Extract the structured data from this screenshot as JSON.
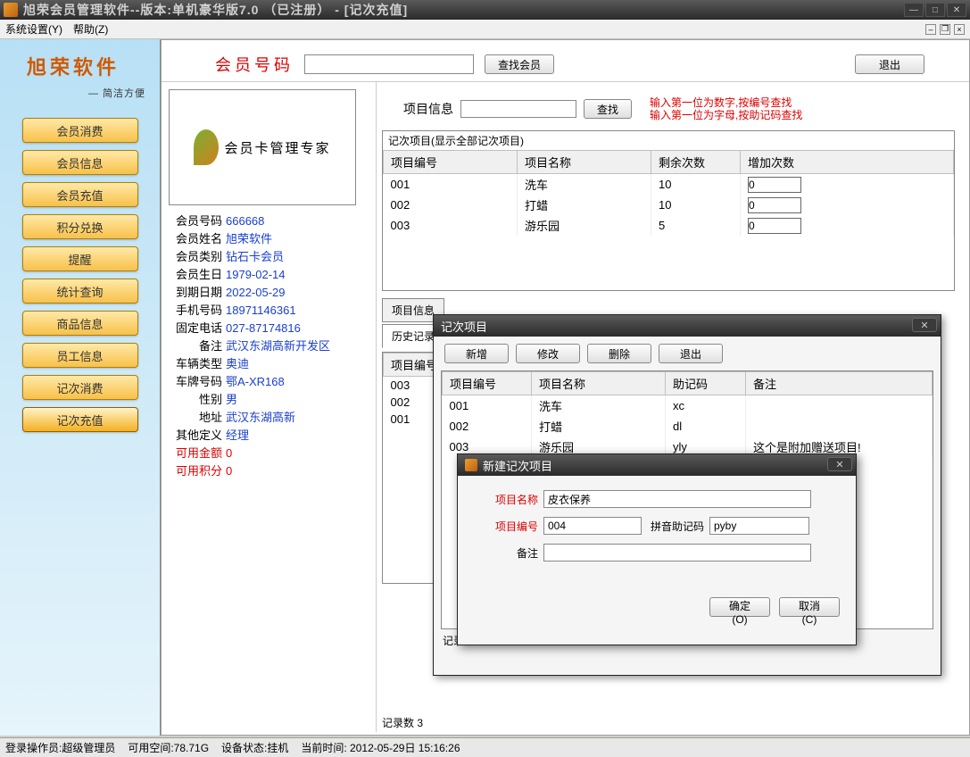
{
  "window": {
    "title": "旭荣会员管理软件--版本:单机豪华版7.0 （已注册） - [记次充值]"
  },
  "menubar": {
    "system": "系统设置(Y)",
    "help": "帮助(Z)"
  },
  "logo": {
    "name": "旭荣软件",
    "slogan": "— 简洁方便"
  },
  "sidebar": {
    "items": [
      {
        "label": "会员消费"
      },
      {
        "label": "会员信息"
      },
      {
        "label": "会员充值"
      },
      {
        "label": "积分兑换"
      },
      {
        "label": "提醒"
      },
      {
        "label": "统计查询"
      },
      {
        "label": "商品信息"
      },
      {
        "label": "员工信息"
      },
      {
        "label": "记次消费"
      },
      {
        "label": "记次充值"
      }
    ]
  },
  "top": {
    "member_no_label": "会员号码",
    "find_member": "查找会员",
    "exit": "退出"
  },
  "card_text": "会员卡管理专家",
  "member": {
    "no_k": "会员号码",
    "no_v": "666668",
    "name_k": "会员姓名",
    "name_v": "旭荣软件",
    "type_k": "会员类别",
    "type_v": "钻石卡会员",
    "birth_k": "会员生日",
    "birth_v": "1979-02-14",
    "expire_k": "到期日期",
    "expire_v": "2022-05-29",
    "mobile_k": "手机号码",
    "mobile_v": "18971146361",
    "tel_k": "固定电话",
    "tel_v": "027-87174816",
    "remark_k": "备注",
    "remark_v": "武汉东湖高新开发区",
    "car_k": "车辆类型",
    "car_v": "奥迪",
    "plate_k": "车牌号码",
    "plate_v": "鄂A-XR168",
    "sex_k": "性别",
    "sex_v": "男",
    "addr_k": "地址",
    "addr_v": "武汉东湖高新",
    "custom_k": "其他定义",
    "custom_v": "经理",
    "balance_k": "可用金额",
    "balance_v": "0",
    "points_k": "可用积分",
    "points_v": "0"
  },
  "proj": {
    "label": "项目信息",
    "find": "查找",
    "hint1": "输入第一位为数字,按编号查找",
    "hint2": "输入第一位为字母,按助记码查找",
    "list_title": "记次项目(显示全部记次项目)",
    "cols": {
      "code": "项目编号",
      "name": "项目名称",
      "remain": "剩余次数",
      "add": "增加次数"
    },
    "rows": [
      {
        "code": "001",
        "name": "洗车",
        "remain": "10",
        "add": "0"
      },
      {
        "code": "002",
        "name": "打蜡",
        "remain": "10",
        "add": "0"
      },
      {
        "code": "003",
        "name": "游乐园",
        "remain": "5",
        "add": "0"
      }
    ]
  },
  "tabs": {
    "info": "项目信息",
    "history": "历史记录"
  },
  "hist": {
    "cols": {
      "code": "项目编号"
    },
    "rows": [
      {
        "code": "003"
      },
      {
        "code": "002"
      },
      {
        "code": "001"
      }
    ]
  },
  "dlg1": {
    "title": "记次项目",
    "add": "新增",
    "edit": "修改",
    "del": "删除",
    "exit": "退出",
    "cols": {
      "code": "项目编号",
      "name": "项目名称",
      "mnem": "助记码",
      "remark": "备注"
    },
    "rows": [
      {
        "code": "001",
        "name": "洗车",
        "mnem": "xc",
        "remark": ""
      },
      {
        "code": "002",
        "name": "打蜡",
        "mnem": "dl",
        "remark": ""
      },
      {
        "code": "003",
        "name": "游乐园",
        "mnem": "yly",
        "remark": "这个是附加赠送项目!"
      }
    ],
    "count": "记录数 3"
  },
  "dlg2": {
    "title": "新建记次项目",
    "name_lbl": "项目名称",
    "name_val": "皮衣保养",
    "code_lbl": "项目编号",
    "code_val": "004",
    "mnem_lbl": "拼音助记码",
    "mnem_val": "pyby",
    "remark_lbl": "备注",
    "remark_val": "",
    "ok": "确定(O)",
    "cancel": "取消(C)"
  },
  "footer": "记录数 3",
  "status": {
    "op": "登录操作员:超级管理员",
    "space": "可用空间:78.71G",
    "dev": "设备状态:挂机",
    "time": "当前时间: 2012-05-29日 15:16:26"
  }
}
